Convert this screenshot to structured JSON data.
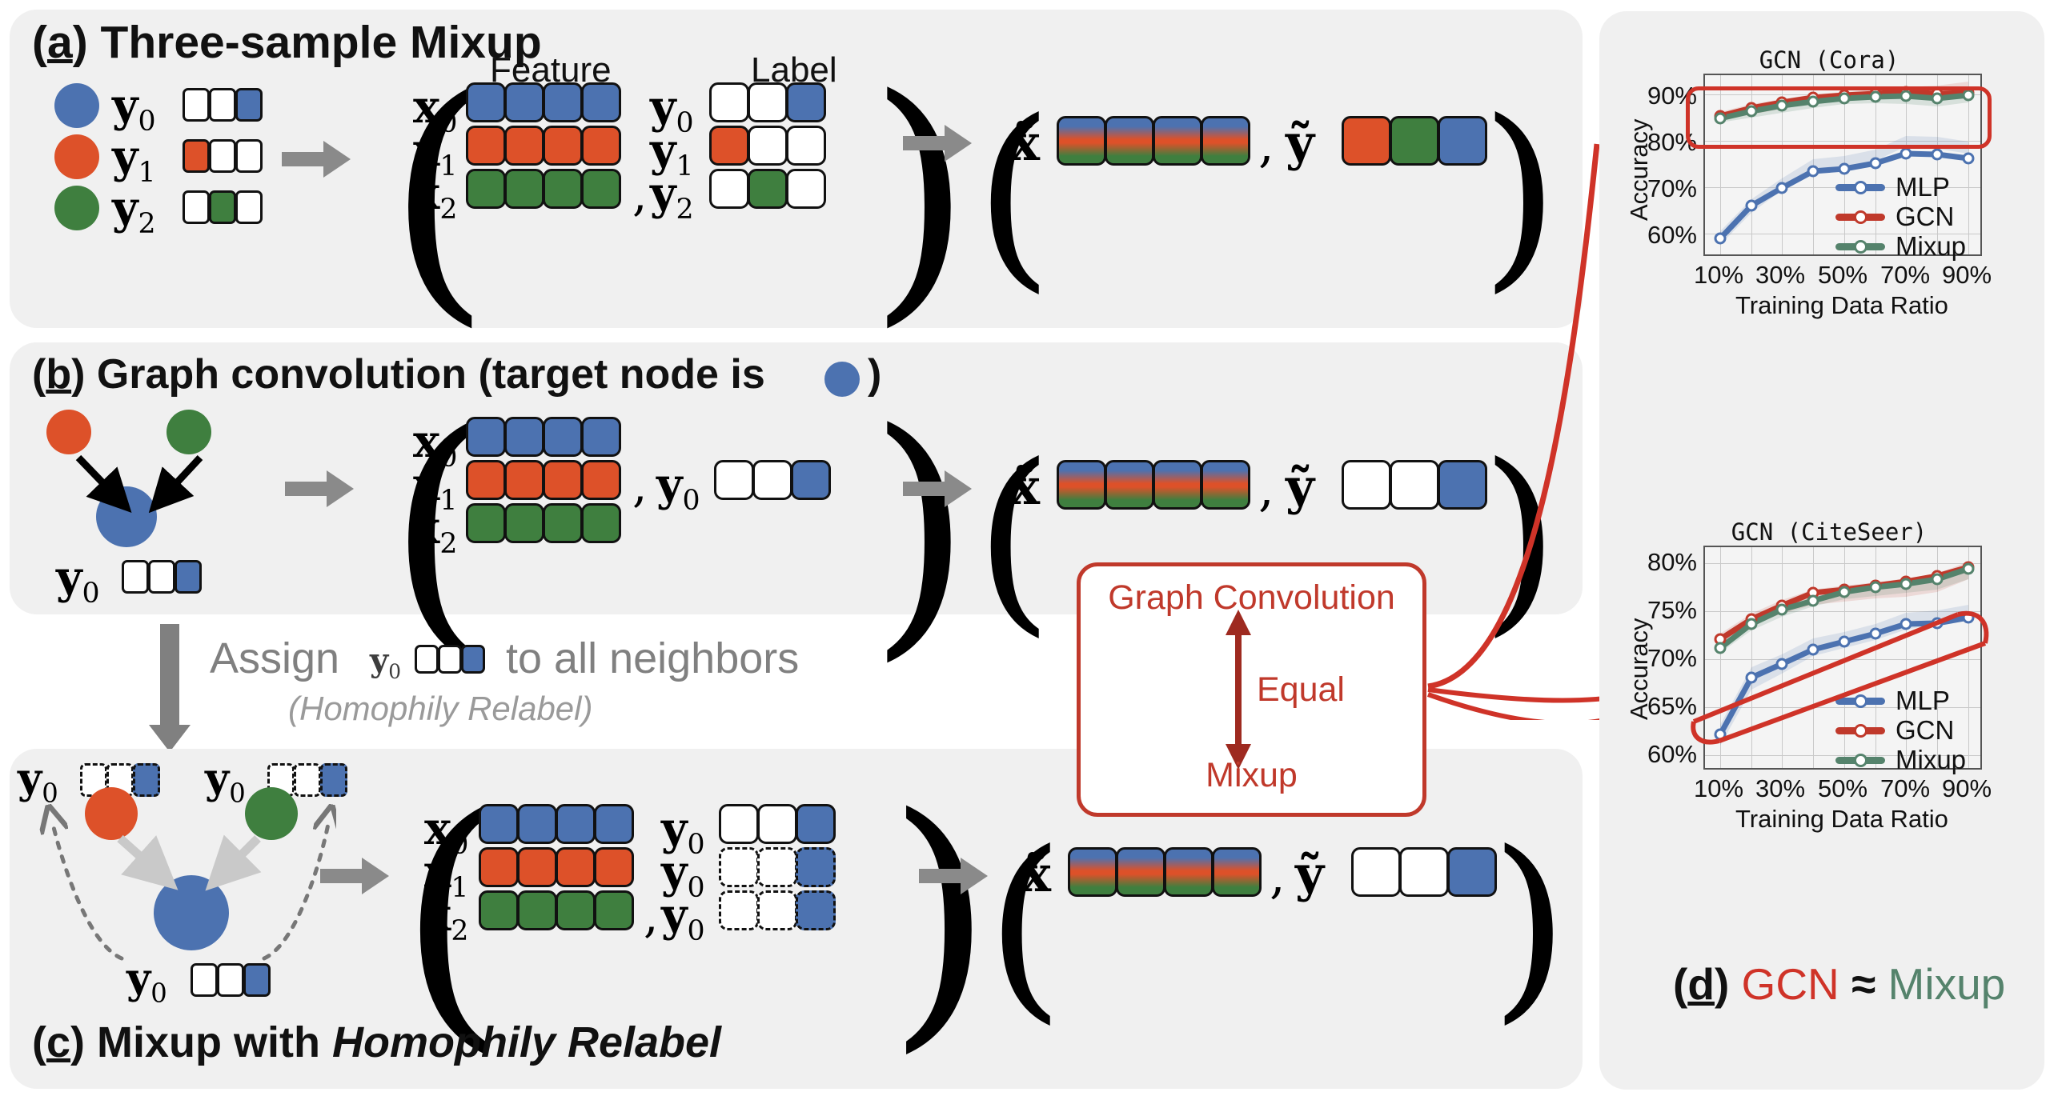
{
  "figure": {
    "panels": {
      "a": {
        "caption_prefix": "(",
        "caption_letter": "a",
        "caption_suffix": ") Three-sample Mixup",
        "col_header_feature": "Feature",
        "col_header_label": "Label"
      },
      "b": {
        "caption_text_before": ") Graph convolution (target node is",
        "caption_letter": "b",
        "caption_text_after": ")"
      },
      "c": {
        "caption_letter": "c",
        "caption_text": ") Mixup with ",
        "caption_italic": "Homophily Relabel"
      },
      "d": {
        "caption_letter": "d",
        "caption_gcn": "GCN",
        "caption_approx": "≈",
        "caption_mixup": "Mixup"
      }
    },
    "assign": {
      "line1_a": "Assign",
      "line1_sym": "y",
      "line1_sub": "0",
      "line1_b": "to all neighbors",
      "line2": "(Homophily Relabel)"
    },
    "equal_box": {
      "top": "Graph Convolution",
      "middle": "Equal",
      "bottom": "Mixup"
    },
    "symbols": {
      "x0": "x",
      "x1": "x",
      "x2": "x",
      "y0": "y",
      "y1": "y",
      "y2": "y",
      "xt": "x̃",
      "yt": "ỹ",
      "sub0": "0",
      "sub1": "1",
      "sub2": "2",
      "comma": ","
    },
    "colors": {
      "blue": "#4c72b0",
      "orange": "#dd5129",
      "green": "#3f7f3f",
      "red_accent": "#cf3328",
      "mixup_green": "#55836c",
      "panel_bg": "#f0f0f0",
      "grey_arrow": "#808080"
    }
  },
  "chart_data": [
    {
      "type": "line",
      "title": "GCN (Cora)",
      "xlabel": "Training Data Ratio",
      "ylabel": "Accuracy",
      "x": [
        10,
        20,
        30,
        40,
        50,
        60,
        70,
        80,
        90
      ],
      "xticklabels": [
        "10%",
        "30%",
        "50%",
        "70%",
        "90%"
      ],
      "xtickvals": [
        10,
        30,
        50,
        70,
        90
      ],
      "yticklabels": [
        "60%",
        "70%",
        "80%",
        "90%"
      ],
      "ytickvals": [
        60,
        70,
        80,
        90
      ],
      "ylim": [
        56,
        92
      ],
      "xlim": [
        5,
        95
      ],
      "grid": true,
      "legend_position": "lower right",
      "series": [
        {
          "name": "MLP",
          "color": "#4c72b0",
          "values": [
            59.0,
            65.4,
            68.9,
            72.1,
            72.5,
            73.5,
            75.4,
            75.3,
            74.5
          ]
        },
        {
          "name": "GCN",
          "color": "#c0392b",
          "values": [
            84.0,
            85.5,
            86.6,
            87.4,
            87.9,
            88.2,
            88.5,
            88.2,
            88.4
          ]
        },
        {
          "name": "Mixup",
          "color": "#55836c",
          "values": [
            83.5,
            85.3,
            86.3,
            87.1,
            87.7,
            87.9,
            88.0,
            87.6,
            88.2
          ]
        }
      ],
      "annotation": "red rounded box highlighting GCN and Mixup curves between 80% and 90%"
    },
    {
      "type": "line",
      "title": "GCN (CiteSeer)",
      "xlabel": "Training Data Ratio",
      "ylabel": "Accuracy",
      "x": [
        10,
        20,
        30,
        40,
        50,
        60,
        70,
        80,
        90
      ],
      "xticklabels": [
        "10%",
        "30%",
        "50%",
        "70%",
        "90%"
      ],
      "xtickvals": [
        10,
        30,
        50,
        70,
        90
      ],
      "yticklabels": [
        "60%",
        "65%",
        "70%",
        "75%",
        "80%"
      ],
      "ytickvals": [
        60,
        65,
        70,
        75,
        80
      ],
      "ylim": [
        59,
        81.5
      ],
      "xlim": [
        5,
        95
      ],
      "grid": true,
      "legend_position": "lower right",
      "series": [
        {
          "name": "MLP",
          "color": "#4c72b0",
          "values": [
            61.3,
            67.2,
            68.6,
            70.0,
            70.8,
            71.6,
            72.6,
            72.7,
            73.3
          ]
        },
        {
          "name": "GCN",
          "color": "#c0392b",
          "values": [
            70.4,
            72.5,
            73.9,
            75.2,
            75.6,
            76.0,
            76.4,
            77.0,
            77.9
          ]
        },
        {
          "name": "Mixup",
          "color": "#55836c",
          "values": [
            69.5,
            72.0,
            73.5,
            74.4,
            75.3,
            75.8,
            76.2,
            76.7,
            77.7
          ]
        }
      ],
      "annotation": "red rotated rounded box highlighting GCN and Mixup curves"
    }
  ]
}
